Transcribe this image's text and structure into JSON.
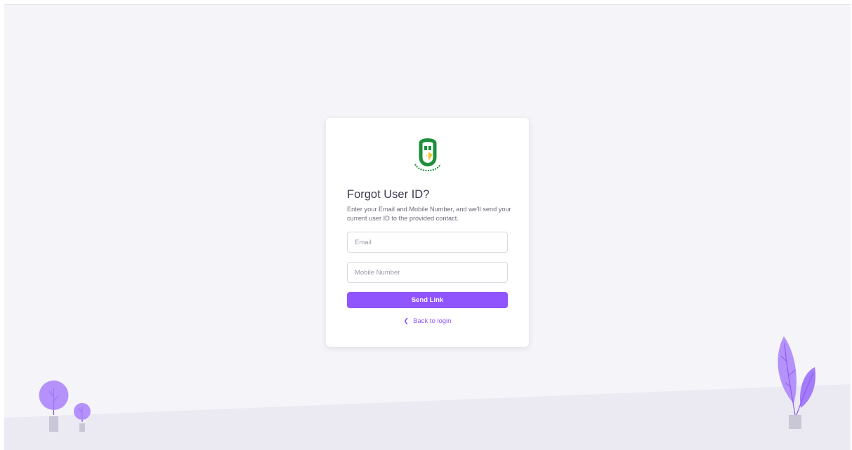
{
  "colors": {
    "accent": "#9155fd",
    "background": "#f5f5f9",
    "ground": "#ebeaf2",
    "logo_green": "#1f8f3a",
    "logo_yellow": "#f2c230"
  },
  "card": {
    "logo_icon": "green-shield-logo-icon",
    "title": "Forgot User ID?",
    "subtitle": "Enter your Email and Mobile Number, and we'll send your current user ID to the provided contact.",
    "email": {
      "placeholder": "Email",
      "value": ""
    },
    "mobile": {
      "placeholder": "Mobile Number",
      "value": ""
    },
    "submit_label": "Send Link",
    "back_icon": "chevron-left-icon",
    "back_label": "Back to login"
  },
  "decorations": {
    "left": "tree-illustration-icon",
    "right": "plant-illustration-icon"
  }
}
